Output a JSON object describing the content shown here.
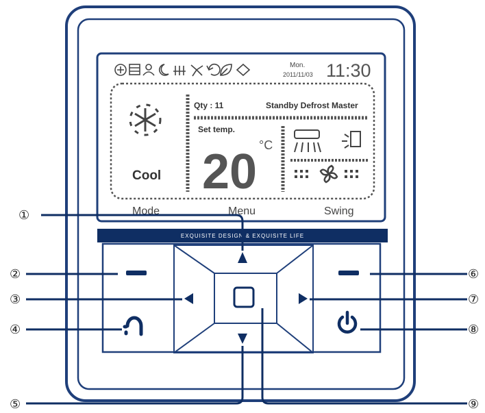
{
  "colors": {
    "outline": "#1f3f7a",
    "banner": "#0f2e63",
    "text": "#2b2b2b",
    "lcd_gray": "#5a5a5a"
  },
  "status_icons": [
    "ion-icon",
    "filter-icon",
    "person-icon",
    "moon-icon",
    "heat-icon",
    "fan-icon",
    "refresh-icon",
    "leaf-icon",
    "diamond-icon"
  ],
  "lcd": {
    "day": "Mon.",
    "date": "2011/11/03",
    "time": "11:30",
    "mode": "Cool",
    "qty": "Qty : 11",
    "status": "Standby Defrost Master",
    "set_temp_label": "Set temp.",
    "temperature": "20",
    "unit": "°C"
  },
  "soft_labels": {
    "left": "Mode",
    "center": "Menu",
    "right": "Swing"
  },
  "banner": "EXQUISITE DESIGN & EXQUISITE LIFE",
  "callouts": [
    "①",
    "②",
    "③",
    "④",
    "⑤",
    "⑥",
    "⑦",
    "⑧",
    "⑨"
  ]
}
